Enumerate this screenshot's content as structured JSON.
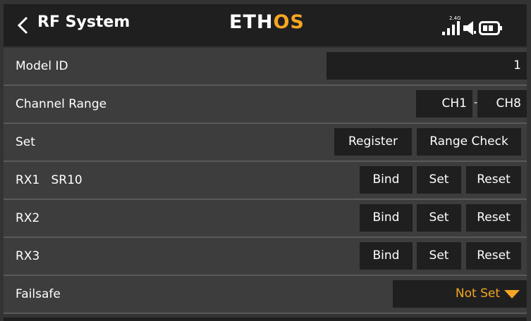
{
  "header": {
    "title": "RF System",
    "logo_main": "ETH",
    "logo_accent": "OS",
    "band": "2.4G"
  },
  "rows": {
    "model_id": {
      "label": "Model ID",
      "value": "1"
    },
    "channel_range": {
      "label": "Channel Range",
      "from": "CH1",
      "separator": "-",
      "to": "CH8"
    },
    "set": {
      "label": "Set",
      "register": "Register",
      "range_check": "Range Check"
    },
    "rx1": {
      "label": "RX1   SR10",
      "bind": "Bind",
      "set": "Set",
      "reset": "Reset"
    },
    "rx2": {
      "label": "RX2",
      "bind": "Bind",
      "set": "Set",
      "reset": "Reset"
    },
    "rx3": {
      "label": "RX3",
      "bind": "Bind",
      "set": "Set",
      "reset": "Reset"
    },
    "failsafe": {
      "label": "Failsafe",
      "value": "Not Set"
    }
  },
  "colors": {
    "accent": "#f5a623",
    "header_bg": "#1f1f1f",
    "row_bg": "#3d3d3d",
    "button_bg": "#1f1f1f"
  },
  "icons": [
    "back-chevron-icon",
    "signal-bars-icon",
    "speaker-icon",
    "battery-icon",
    "dropdown-triangle-icon"
  ]
}
